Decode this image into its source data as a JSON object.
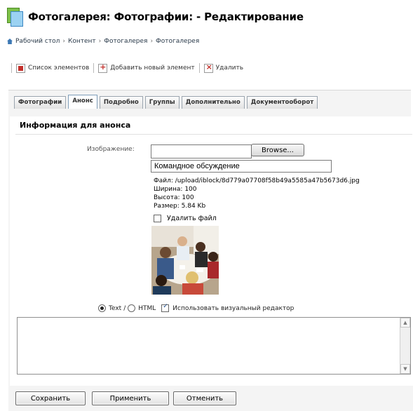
{
  "header": {
    "title": "Фотогалерея: Фотографии: - Редактирование"
  },
  "breadcrumb": [
    "Рабочий стол",
    "Контент",
    "Фотогалерея",
    "Фотогалерея"
  ],
  "breadcrumb_sep": "›",
  "toolbar": {
    "list_label": "Список элементов",
    "add_label": "Добавить новый элемент",
    "delete_label": "Удалить"
  },
  "tabs": [
    {
      "label": "Фотографии",
      "active": false
    },
    {
      "label": "Анонс",
      "active": true
    },
    {
      "label": "Подробно",
      "active": false
    },
    {
      "label": "Группы",
      "active": false
    },
    {
      "label": "Дополнительно",
      "active": false
    },
    {
      "label": "Документооборот",
      "active": false
    }
  ],
  "section": {
    "heading": "Информация для анонса",
    "image_label": "Изображение:",
    "file_input_value": "",
    "browse_label": "Browse...",
    "description_value": "Командное обсуждение",
    "file_info": {
      "file": "Файл: /upload/iblock/8d779a07708f58b49a5585a47b5673d6.jpg",
      "width": "Ширина: 100",
      "height": "Высота: 100",
      "size": "Размер: 5.84 Kb"
    },
    "delete_file_label": "Удалить файл",
    "delete_file_checked": false
  },
  "editor": {
    "text_label": "Text",
    "sep": "/",
    "html_label": "HTML",
    "mode": "text",
    "visual_label": "Использовать визуальный редактор",
    "visual_checked": true,
    "content": ""
  },
  "footer": {
    "save_label": "Сохранить",
    "apply_label": "Применить",
    "cancel_label": "Отменить"
  },
  "colors": {
    "accent_red": "#c4302b",
    "tab_border": "#7f9db9"
  }
}
